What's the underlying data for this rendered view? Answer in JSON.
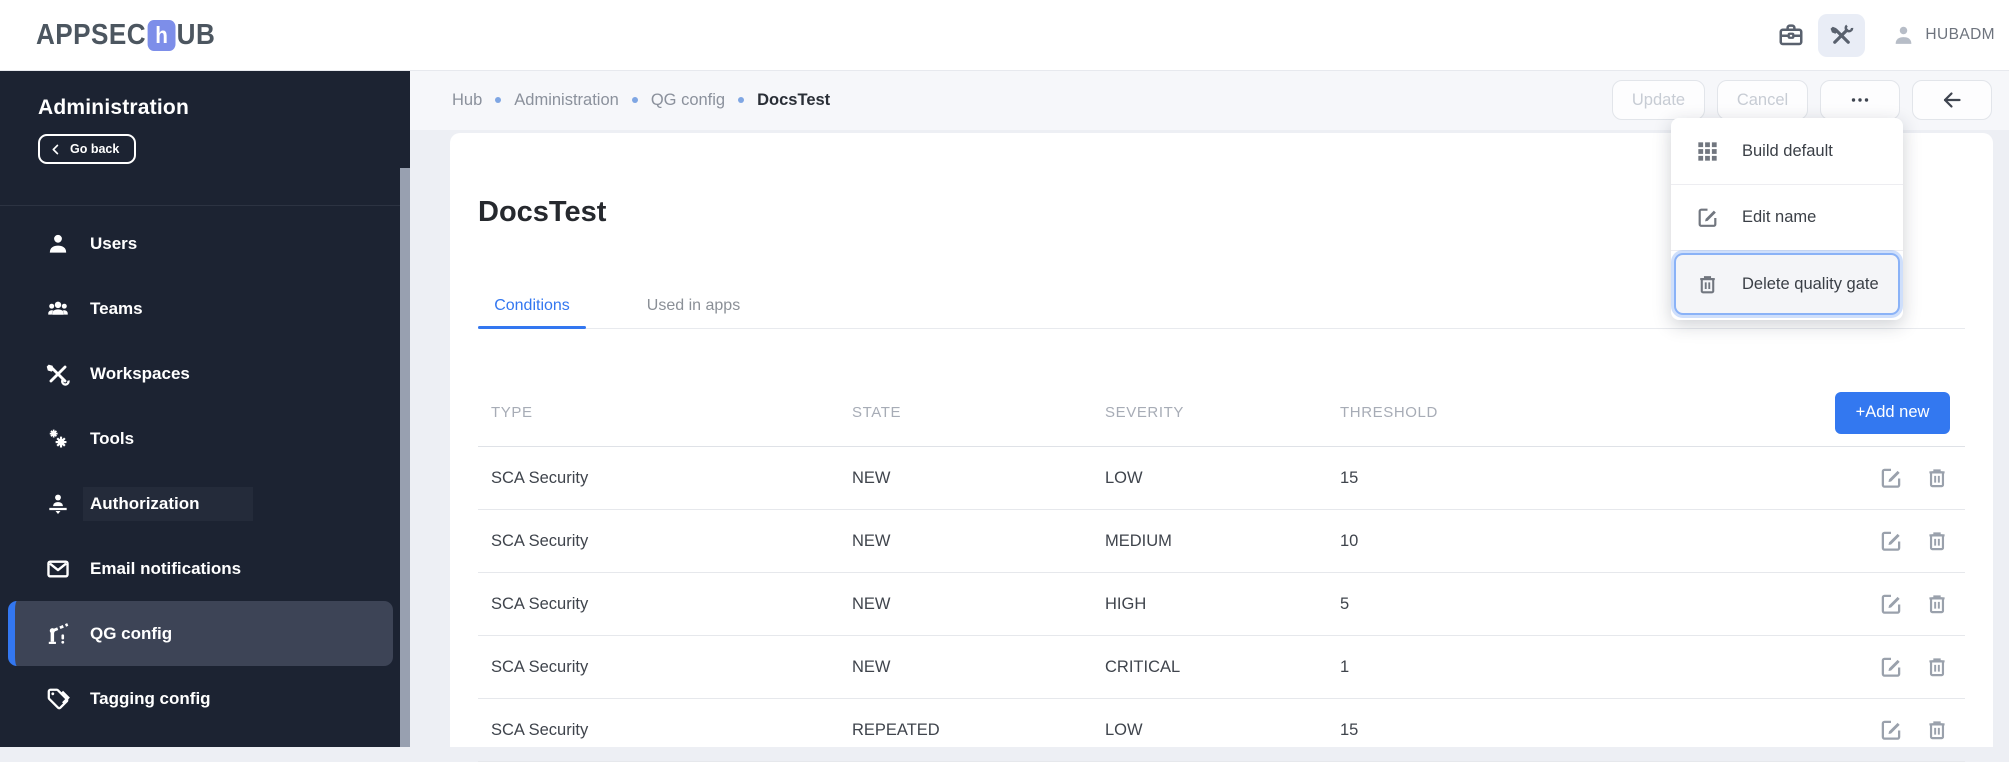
{
  "theme": {
    "accent_blue": "#3377f0",
    "sidebar_bg": "#1c2332",
    "sidebar_active_bg": "#3d4456",
    "page_bg": "#edeff4",
    "card_bg": "#ffffff",
    "logo_mark_bg": "#7d8ee9",
    "disabled_text": "#c7ccd4"
  },
  "topbar": {
    "logo_prefix": "APPSEC",
    "logo_mark": "h",
    "logo_suffix": "UB",
    "user_name": "HUBADM",
    "icons": [
      "briefcase-icon",
      "tools-icon",
      "person-icon"
    ]
  },
  "sidebar": {
    "title": "Administration",
    "go_back_label": "Go back",
    "items": [
      {
        "label": "Users",
        "icon": "user-icon"
      },
      {
        "label": "Teams",
        "icon": "teams-icon"
      },
      {
        "label": "Workspaces",
        "icon": "workspaces-icon"
      },
      {
        "label": "Tools",
        "icon": "gears-icon"
      },
      {
        "label": "Authorization",
        "icon": "authorization-icon",
        "highlighted": true
      },
      {
        "label": "Email notifications",
        "icon": "mail-icon"
      },
      {
        "label": "QG config",
        "icon": "boom-gate-icon",
        "active": true
      },
      {
        "label": "Tagging config",
        "icon": "tag-icon"
      }
    ]
  },
  "breadcrumb": {
    "items": [
      "Hub",
      "Administration",
      "QG config"
    ],
    "current": "DocsTest"
  },
  "header_actions": {
    "update_label": "Update",
    "cancel_label": "Cancel",
    "more_icon": "ellipsis-icon",
    "back_icon": "arrow-left-icon"
  },
  "menu": {
    "items": [
      {
        "label": "Build default",
        "icon": "grid-icon"
      },
      {
        "label": "Edit name",
        "icon": "edit-icon"
      },
      {
        "label": "Delete quality gate",
        "icon": "trash-icon",
        "focused": true
      }
    ]
  },
  "page": {
    "title": "DocsTest",
    "tabs": [
      {
        "label": "Conditions",
        "active": true
      },
      {
        "label": "Used in apps",
        "active": false
      }
    ]
  },
  "table": {
    "columns": [
      "TYPE",
      "STATE",
      "SEVERITY",
      "THRESHOLD"
    ],
    "add_button_label": "+Add new",
    "row_actions": [
      "edit-icon",
      "trash-icon"
    ],
    "rows": [
      {
        "type": "SCA Security",
        "state": "NEW",
        "severity": "LOW",
        "threshold": "15"
      },
      {
        "type": "SCA Security",
        "state": "NEW",
        "severity": "MEDIUM",
        "threshold": "10"
      },
      {
        "type": "SCA Security",
        "state": "NEW",
        "severity": "HIGH",
        "threshold": "5"
      },
      {
        "type": "SCA Security",
        "state": "NEW",
        "severity": "CRITICAL",
        "threshold": "1"
      },
      {
        "type": "SCA Security",
        "state": "REPEATED",
        "severity": "LOW",
        "threshold": "15"
      }
    ]
  }
}
